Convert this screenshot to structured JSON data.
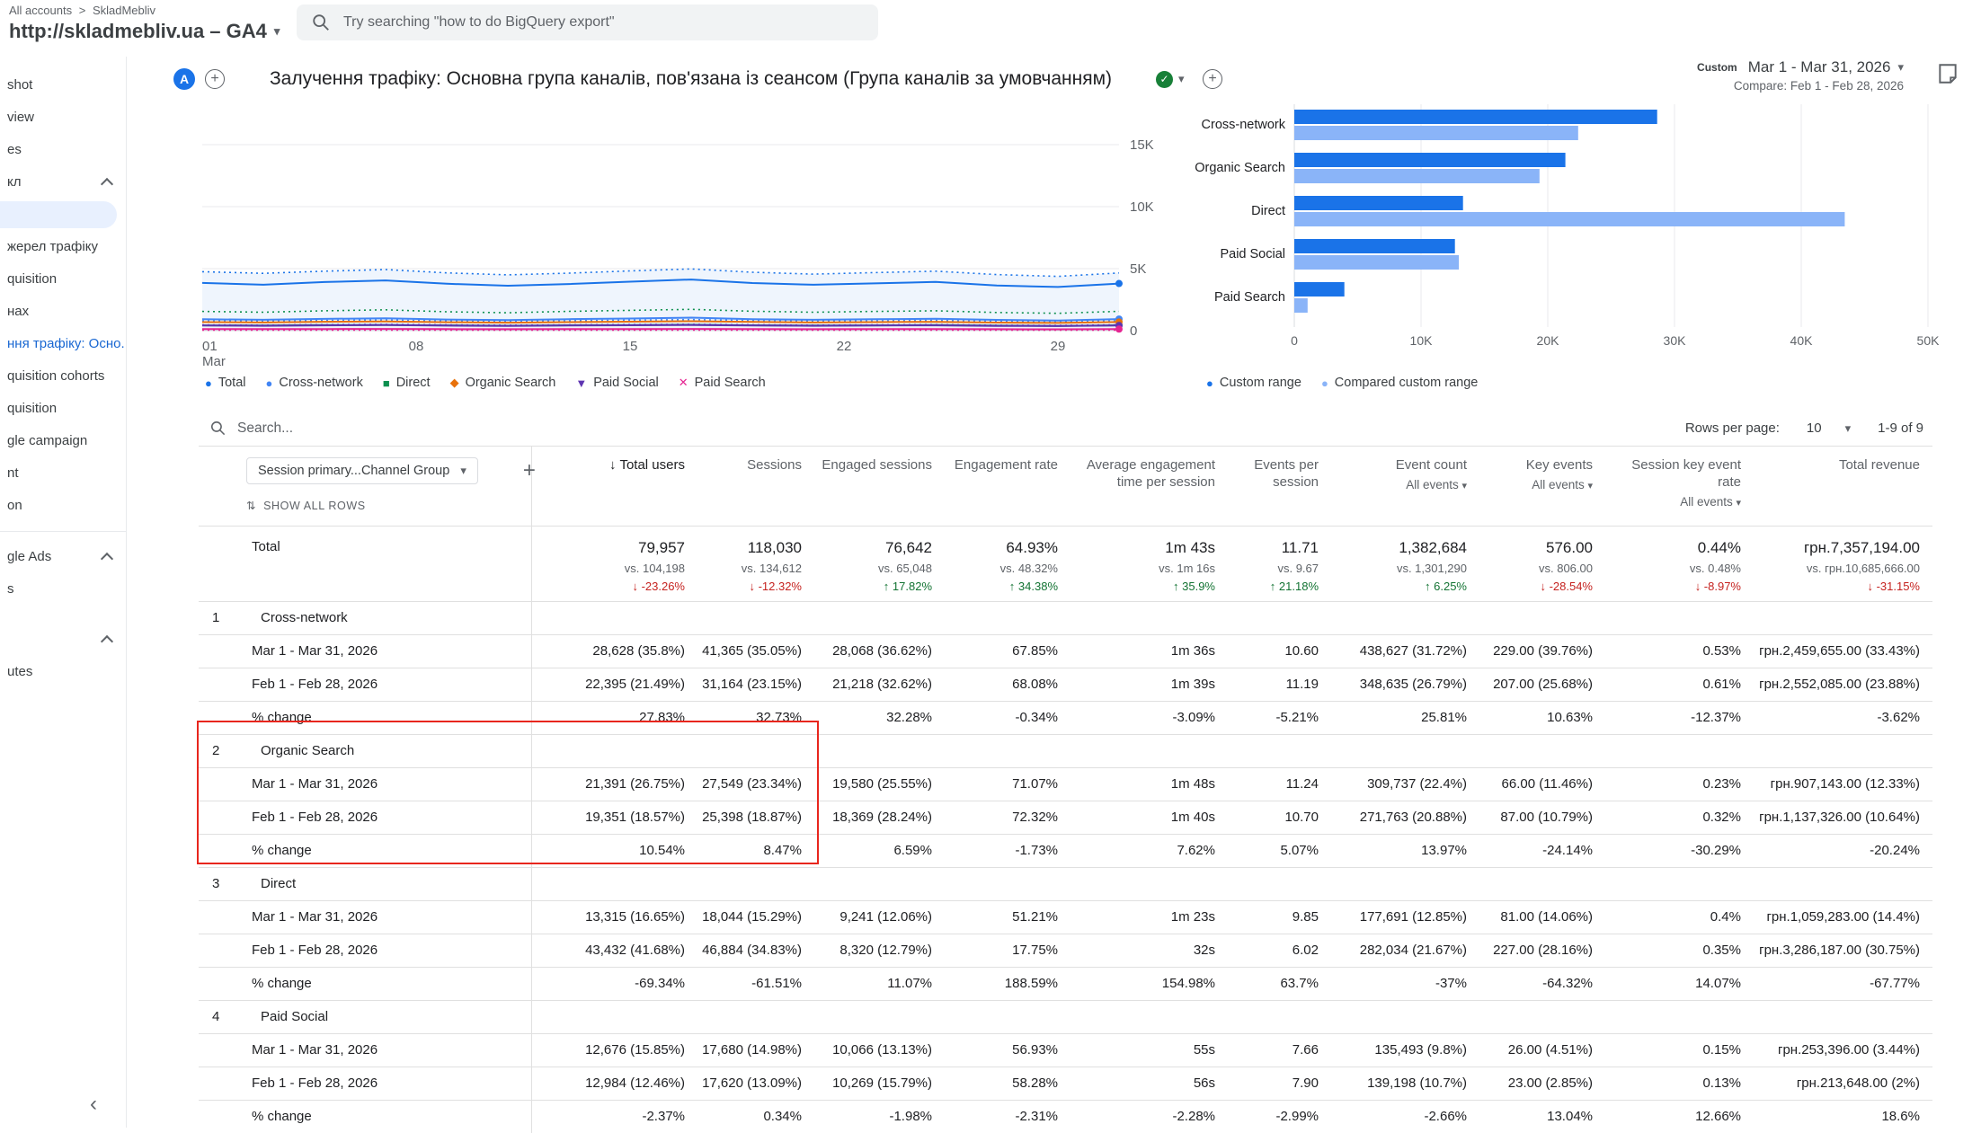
{
  "topbar": {
    "breadcrumb_root": "All accounts",
    "breadcrumb_account": "SkladMebliv",
    "property_title": "http://skladmebliv.ua – GA4",
    "search_placeholder": "Try searching \"how to do BigQuery export\""
  },
  "sidebar": {
    "items": [
      {
        "label": "shot"
      },
      {
        "label": "view"
      },
      {
        "label": "es"
      },
      {
        "label": "кл",
        "chevron": true
      },
      {
        "type": "pill"
      },
      {
        "label": "жерел трафіку"
      },
      {
        "label": "quisition"
      },
      {
        "label": "нах"
      },
      {
        "label": "ння трафіку: Осно...",
        "active": true
      },
      {
        "label": "quisition cohorts"
      },
      {
        "label": "quisition"
      },
      {
        "label": "gle campaign"
      },
      {
        "label": "nt"
      },
      {
        "label": "on"
      },
      {
        "type": "divider"
      },
      {
        "label": "gle Ads",
        "chevron": true
      },
      {
        "label": "s"
      },
      {
        "label": "",
        "chevron": true,
        "mt": true
      },
      {
        "label": "utes"
      }
    ],
    "collapse_icon": "‹"
  },
  "report_header": {
    "avatar_letter": "A",
    "title": "Залучення трафіку: Основна група каналів, пов'язана із сеансом (Група каналів за умовчанням)",
    "range_type": "Custom",
    "date_range": "Mar 1 - Mar 31, 2026",
    "compare": "Compare: Feb 1 - Feb 28, 2026"
  },
  "chart_data": [
    {
      "type": "line",
      "x_axis": {
        "labels": [
          "01 Mar",
          "08",
          "15",
          "22",
          "29"
        ],
        "days": 31,
        "month": "Mar"
      },
      "y_axis": {
        "ticks": [
          [
            0,
            "0"
          ],
          [
            5000,
            "5K"
          ],
          [
            10000,
            "10K"
          ],
          [
            15000,
            "15K"
          ]
        ],
        "max": 17500
      },
      "series": [
        {
          "name": "Total",
          "color": "#1a73e8",
          "glyph": "●",
          "current": [
            3850,
            3700,
            3920,
            4050,
            3780,
            3620,
            3760,
            3950,
            4120,
            3840,
            3700,
            3810,
            3930,
            3640,
            3520,
            3800
          ],
          "compare": [
            4750,
            4620,
            4800,
            4930,
            4660,
            4500,
            4640,
            4820,
            4980,
            4710,
            4560,
            4680,
            4800,
            4520,
            4380,
            4650
          ]
        },
        {
          "name": "Cross-network",
          "color": "#4285f4",
          "glyph": "●",
          "current": [
            920,
            880,
            950,
            1000,
            900,
            850,
            925,
            980,
            1050,
            930,
            880,
            920,
            960,
            870,
            820,
            935
          ],
          "compare": [
            800,
            770,
            825,
            860,
            780,
            745,
            805,
            850,
            900,
            812,
            765,
            800,
            832,
            752,
            715,
            805
          ]
        },
        {
          "name": "Direct",
          "color": "#0d904f",
          "glyph": "■",
          "current": [
            430,
            412,
            446,
            466,
            426,
            402,
            432,
            456,
            476,
            436,
            412,
            430,
            446,
            406,
            386,
            434
          ],
          "compare": [
            1550,
            1485,
            1605,
            1680,
            1520,
            1445,
            1555,
            1640,
            1720,
            1565,
            1485,
            1550,
            1605,
            1465,
            1395,
            1560
          ]
        },
        {
          "name": "Organic Search",
          "color": "#e8710a",
          "glyph": "◆",
          "current": [
            690,
            660,
            715,
            742,
            680,
            645,
            692,
            722,
            760,
            700,
            662,
            690,
            712,
            652,
            622,
            697
          ],
          "compare": [
            700,
            672,
            724,
            752,
            690,
            655,
            702,
            732,
            770,
            710,
            672,
            700,
            722,
            662,
            632,
            707
          ]
        },
        {
          "name": "Paid Social",
          "color": "#5e35b1",
          "glyph": "▼",
          "current": [
            410,
            392,
            426,
            446,
            406,
            382,
            412,
            436,
            456,
            416,
            392,
            410,
            426,
            386,
            366,
            414
          ],
          "compare": [
            465,
            442,
            482,
            506,
            462,
            432,
            467,
            492,
            516,
            472,
            442,
            465,
            482,
            437,
            417,
            470
          ]
        },
        {
          "name": "Paid Search",
          "color": "#e52592",
          "glyph": "✕",
          "current": [
            126,
            120,
            131,
            138,
            124,
            116,
            126,
            134,
            141,
            128,
            119,
            126,
            131,
            118,
            111,
            127
          ],
          "compare": [
            37,
            35,
            39,
            41,
            36,
            34,
            37,
            40,
            42,
            38,
            35,
            37,
            39,
            35,
            33,
            38
          ]
        }
      ]
    },
    {
      "type": "bar",
      "orientation": "horizontal",
      "categories": [
        "Cross-network",
        "Organic Search",
        "Direct",
        "Paid Social",
        "Paid Search"
      ],
      "series": [
        {
          "name": "Custom range",
          "color": "#1a73e8",
          "values": [
            28628,
            21391,
            13315,
            12676,
            3947
          ]
        },
        {
          "name": "Compared custom range",
          "color": "#8ab4f8",
          "values": [
            22395,
            19351,
            43432,
            12984,
            1050
          ]
        }
      ],
      "x_axis": {
        "ticks": [
          "0",
          "10K",
          "20K",
          "30K",
          "40K",
          "50K"
        ],
        "max": 50000
      }
    }
  ],
  "table": {
    "search_placeholder": "Search...",
    "rows_per_page_label": "Rows per page:",
    "rows_per_page_value": "10",
    "pagination": "1-9 of 9",
    "dimension_selector": "Session primary...Channel Group",
    "show_all_rows": "SHOW ALL ROWS",
    "columns": [
      {
        "label": "Total users",
        "sorted": true
      },
      {
        "label": "Sessions"
      },
      {
        "label": "Engaged sessions"
      },
      {
        "label": "Engagement rate"
      },
      {
        "label": "Average engagement time per session"
      },
      {
        "label": "Events per session"
      },
      {
        "label": "Event count",
        "filter": "All events"
      },
      {
        "label": "Key events",
        "filter": "All events"
      },
      {
        "label": "Session key event rate",
        "filter": "All events"
      },
      {
        "label": "Total revenue"
      }
    ],
    "total": {
      "label": "Total",
      "metrics": [
        {
          "value": "79,957",
          "vs": "vs. 104,198",
          "change": "-23.26%",
          "dir": "down"
        },
        {
          "value": "118,030",
          "vs": "vs. 134,612",
          "change": "-12.32%",
          "dir": "down"
        },
        {
          "value": "76,642",
          "vs": "vs. 65,048",
          "change": "17.82%",
          "dir": "up"
        },
        {
          "value": "64.93%",
          "vs": "vs. 48.32%",
          "change": "34.38%",
          "dir": "up"
        },
        {
          "value": "1m 43s",
          "vs": "vs. 1m 16s",
          "change": "35.9%",
          "dir": "up"
        },
        {
          "value": "11.71",
          "vs": "vs. 9.67",
          "change": "21.18%",
          "dir": "up"
        },
        {
          "value": "1,382,684",
          "vs": "vs. 1,301,290",
          "change": "6.25%",
          "dir": "up"
        },
        {
          "value": "576.00",
          "vs": "vs. 806.00",
          "change": "-28.54%",
          "dir": "down"
        },
        {
          "value": "0.44%",
          "vs": "vs. 0.48%",
          "change": "-8.97%",
          "dir": "down"
        },
        {
          "value": "грн.7,357,194.00",
          "vs": "vs. грн.10,685,666.00",
          "change": "-31.15%",
          "dir": "down"
        }
      ]
    },
    "groups": [
      {
        "index": "1",
        "name": "Cross-network",
        "rows": [
          {
            "label": "Mar 1 - Mar 31, 2026",
            "values": [
              "28,628 (35.8%)",
              "41,365 (35.05%)",
              "28,068 (36.62%)",
              "67.85%",
              "1m 36s",
              "10.60",
              "438,627 (31.72%)",
              "229.00 (39.76%)",
              "0.53%",
              "грн.2,459,655.00 (33.43%)"
            ]
          },
          {
            "label": "Feb 1 - Feb 28, 2026",
            "values": [
              "22,395 (21.49%)",
              "31,164 (23.15%)",
              "21,218 (32.62%)",
              "68.08%",
              "1m 39s",
              "11.19",
              "348,635 (26.79%)",
              "207.00 (25.68%)",
              "0.61%",
              "грн.2,552,085.00 (23.88%)"
            ]
          },
          {
            "label": "% change",
            "values": [
              "27.83%",
              "32.73%",
              "32.28%",
              "-0.34%",
              "-3.09%",
              "-5.21%",
              "25.81%",
              "10.63%",
              "-12.37%",
              "-3.62%"
            ]
          }
        ]
      },
      {
        "index": "2",
        "name": "Organic Search",
        "rows": [
          {
            "label": "Mar 1 - Mar 31, 2026",
            "values": [
              "21,391 (26.75%)",
              "27,549 (23.34%)",
              "19,580 (25.55%)",
              "71.07%",
              "1m 48s",
              "11.24",
              "309,737 (22.4%)",
              "66.00 (11.46%)",
              "0.23%",
              "грн.907,143.00 (12.33%)"
            ]
          },
          {
            "label": "Feb 1 - Feb 28, 2026",
            "values": [
              "19,351 (18.57%)",
              "25,398 (18.87%)",
              "18,369 (28.24%)",
              "72.32%",
              "1m 40s",
              "10.70",
              "271,763 (20.88%)",
              "87.00 (10.79%)",
              "0.32%",
              "грн.1,137,326.00 (10.64%)"
            ]
          },
          {
            "label": "% change",
            "values": [
              "10.54%",
              "8.47%",
              "6.59%",
              "-1.73%",
              "7.62%",
              "5.07%",
              "13.97%",
              "-24.14%",
              "-30.29%",
              "-20.24%"
            ]
          }
        ]
      },
      {
        "index": "3",
        "name": "Direct",
        "rows": [
          {
            "label": "Mar 1 - Mar 31, 2026",
            "values": [
              "13,315 (16.65%)",
              "18,044 (15.29%)",
              "9,241 (12.06%)",
              "51.21%",
              "1m 23s",
              "9.85",
              "177,691 (12.85%)",
              "81.00 (14.06%)",
              "0.4%",
              "грн.1,059,283.00 (14.4%)"
            ]
          },
          {
            "label": "Feb 1 - Feb 28, 2026",
            "values": [
              "43,432 (41.68%)",
              "46,884 (34.83%)",
              "8,320 (12.79%)",
              "17.75%",
              "32s",
              "6.02",
              "282,034 (21.67%)",
              "227.00 (28.16%)",
              "0.35%",
              "грн.3,286,187.00 (30.75%)"
            ]
          },
          {
            "label": "% change",
            "values": [
              "-69.34%",
              "-61.51%",
              "11.07%",
              "188.59%",
              "154.98%",
              "63.7%",
              "-37%",
              "-64.32%",
              "14.07%",
              "-67.77%"
            ]
          }
        ]
      },
      {
        "index": "4",
        "name": "Paid Social",
        "rows": [
          {
            "label": "Mar 1 - Mar 31, 2026",
            "values": [
              "12,676 (15.85%)",
              "17,680 (14.98%)",
              "10,066 (13.13%)",
              "56.93%",
              "55s",
              "7.66",
              "135,493 (9.8%)",
              "26.00 (4.51%)",
              "0.15%",
              "грн.253,396.00 (3.44%)"
            ]
          },
          {
            "label": "Feb 1 - Feb 28, 2026",
            "values": [
              "12,984 (12.46%)",
              "17,620 (13.09%)",
              "10,269 (15.79%)",
              "58.28%",
              "56s",
              "7.90",
              "139,198 (10.7%)",
              "23.00 (2.85%)",
              "0.13%",
              "грн.213,648.00 (2%)"
            ]
          },
          {
            "label": "% change",
            "values": [
              "-2.37%",
              "0.34%",
              "-1.98%",
              "-2.31%",
              "-2.28%",
              "-2.99%",
              "-2.66%",
              "13.04%",
              "12.66%",
              "18.6%"
            ]
          }
        ]
      }
    ]
  },
  "annotation": {
    "color": "#e8261d"
  }
}
